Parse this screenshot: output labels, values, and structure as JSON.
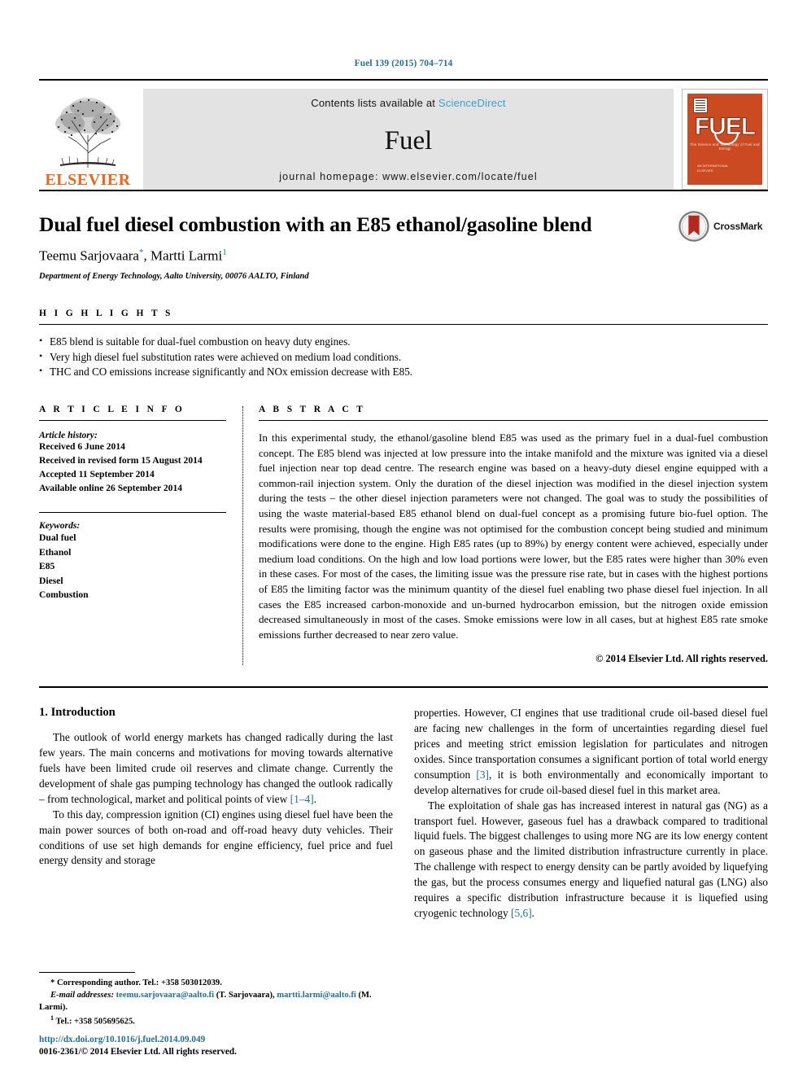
{
  "running_head": "Fuel 139 (2015) 704–714",
  "masthead": {
    "publisher_name": "ELSEVIER",
    "contents_prefix": "Contents lists available at ",
    "contents_link": "ScienceDirect",
    "journal_name": "Fuel",
    "homepage": "journal homepage: www.elsevier.com/locate/fuel",
    "cover": {
      "title": "FUEL",
      "subtitle": "The Science and Technology of Fuel and Energy",
      "footer_line1": "AN INTERNATIONAL",
      "footer_line2": "ELSEVIER"
    }
  },
  "article": {
    "title": "Dual fuel diesel combustion with an E85 ethanol/gasoline blend",
    "author_1": "Teemu Sarjovaara",
    "author_1_mark": "*",
    "author_separator": ", ",
    "author_2": "Martti Larmi",
    "author_2_mark": "1",
    "affiliation": "Department of Energy Technology, Aalto University, 00076 AALTO, Finland",
    "crossmark_label": "CrossMark"
  },
  "highlights": {
    "label": "H I G H L I G H T S",
    "items": [
      "E85 blend is suitable for dual-fuel combustion on heavy duty engines.",
      "Very high diesel fuel substitution rates were achieved on medium load conditions.",
      "THC and CO emissions increase significantly and NOx emission decrease with E85."
    ]
  },
  "article_info": {
    "label": "A R T I C L E   I N F O",
    "history_title": "Article history:",
    "history": [
      "Received 6 June 2014",
      "Received in revised form 15 August 2014",
      "Accepted 11 September 2014",
      "Available online 26 September 2014"
    ],
    "keywords_title": "Keywords:",
    "keywords": [
      "Dual fuel",
      "Ethanol",
      "E85",
      "Diesel",
      "Combustion"
    ]
  },
  "abstract": {
    "label": "A B S T R A C T",
    "text": "In this experimental study, the ethanol/gasoline blend E85 was used as the primary fuel in a dual-fuel combustion concept. The E85 blend was injected at low pressure into the intake manifold and the mixture was ignited via a diesel fuel injection near top dead centre. The research engine was based on a heavy-duty diesel engine equipped with a common-rail injection system. Only the duration of the diesel injection was modified in the diesel injection system during the tests – the other diesel injection parameters were not changed. The goal was to study the possibilities of using the waste material-based E85 ethanol blend on dual-fuel concept as a promising future bio-fuel option. The results were promising, though the engine was not optimised for the combustion concept being studied and minimum modifications were done to the engine. High E85 rates (up to 89%) by energy content were achieved, especially under medium load conditions. On the high and low load portions were lower, but the E85 rates were higher than 30% even in these cases. For most of the cases, the limiting issue was the pressure rise rate, but in cases with the highest portions of E85 the limiting factor was the minimum quantity of the diesel fuel enabling two phase diesel fuel injection. In all cases the E85 increased carbon-monoxide and un-burned hydrocarbon emission, but the nitrogen oxide emission decreased simultaneously in most of the cases. Smoke emissions were low in all cases, but at highest E85 rate smoke emissions further decreased to near zero value.",
    "copyright": "© 2014 Elsevier Ltd. All rights reserved."
  },
  "introduction": {
    "heading": "1. Introduction",
    "left_para_1_a": "The outlook of world energy markets has changed radically during the last few years. The main concerns and motivations for moving towards alternative fuels have been limited crude oil reserves and climate change. Currently the development of shale gas pumping technology has changed the outlook radically – from technological, market and political points of view ",
    "left_para_1_cite": "[1–4]",
    "left_para_1_b": ".",
    "left_para_2": "To this day, compression ignition (CI) engines using diesel fuel have been the main power sources of both on-road and off-road heavy duty vehicles. Their conditions of use set high demands for engine efficiency, fuel price and fuel energy density and storage",
    "right_para_1_a": "properties. However, CI engines that use traditional crude oil-based diesel fuel are facing new challenges in the form of uncertainties regarding diesel fuel prices and meeting strict emission legislation for particulates and nitrogen oxides. Since transportation consumes a significant portion of total world energy consumption ",
    "right_para_1_cite": "[3]",
    "right_para_1_b": ", it is both environmentally and economically important to develop alternatives for crude oil-based diesel fuel in this market area.",
    "right_para_2_a": "The exploitation of shale gas has increased interest in natural gas (NG) as a transport fuel. However, gaseous fuel has a drawback compared to traditional liquid fuels. The biggest challenges to using more NG are its low energy content on gaseous phase and the limited distribution infrastructure currently in place. The challenge with respect to energy density can be partly avoided by liquefying the gas, but the process consumes energy and liquefied natural gas (LNG) also requires a specific distribution infrastructure because it is liquefied using cryogenic technology ",
    "right_para_2_cite": "[5,6]",
    "right_para_2_b": "."
  },
  "footnotes": {
    "corresponding": "* Corresponding author. Tel.: +358 503012039.",
    "email_label": "E-mail addresses:",
    "email_1": "teemu.sarjovaara@aalto.fi",
    "email_1_owner": " (T. Sarjovaara), ",
    "email_2": "martti.larmi@aalto.fi",
    "email_2_owner": " (M. Larmi).",
    "tel_mark": "1",
    "tel": " Tel.: +358 505695625.",
    "doi": "http://dx.doi.org/10.1016/j.fuel.2014.09.049",
    "issn": "0016-2361/© 2014 Elsevier Ltd. All rights reserved."
  }
}
